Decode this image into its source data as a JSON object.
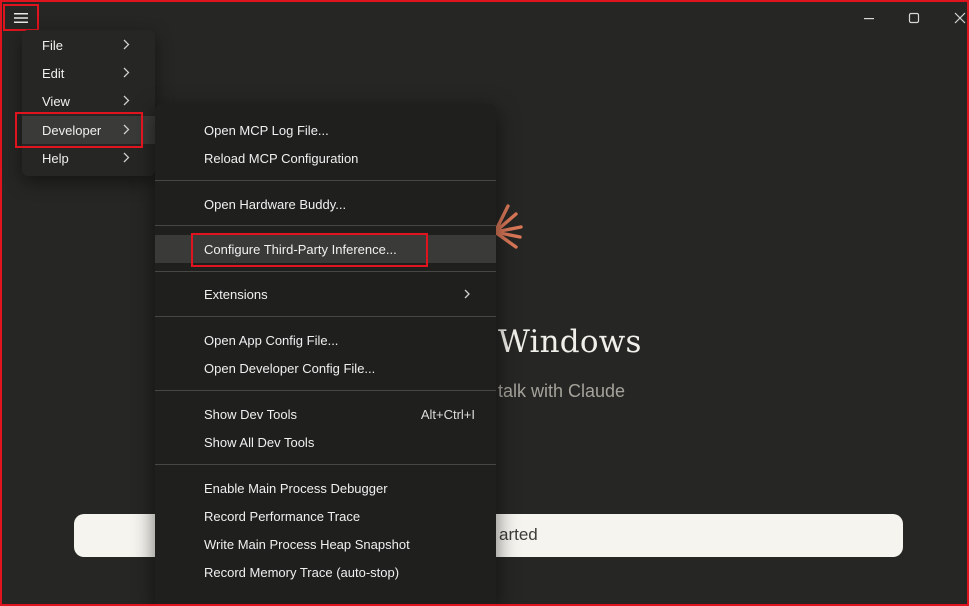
{
  "titlebar": {
    "menu_button_icon": "hamburger-icon",
    "minimize_icon": "minimize-icon",
    "maximize_icon": "maximize-icon",
    "close_icon": "close-icon"
  },
  "welcome": {
    "title_fragment": "Windows",
    "subtitle_fragment": "talk with Claude",
    "button_fragment": "arted"
  },
  "main_menu": {
    "items": [
      {
        "label": "File"
      },
      {
        "label": "Edit"
      },
      {
        "label": "View"
      },
      {
        "label": "Developer"
      },
      {
        "label": "Help"
      }
    ]
  },
  "developer_menu": {
    "items": [
      {
        "label": "Open MCP Log File..."
      },
      {
        "label": "Reload MCP Configuration"
      },
      {
        "label": "Open Hardware Buddy..."
      },
      {
        "label": "Configure Third-Party Inference..."
      },
      {
        "label": "Extensions"
      },
      {
        "label": "Open App Config File..."
      },
      {
        "label": "Open Developer Config File..."
      },
      {
        "label": "Show Dev Tools",
        "shortcut": "Alt+Ctrl+I"
      },
      {
        "label": "Show All Dev Tools"
      },
      {
        "label": "Enable Main Process Debugger"
      },
      {
        "label": "Record Performance Trace"
      },
      {
        "label": "Write Main Process Heap Snapshot"
      },
      {
        "label": "Record Memory Trace (auto-stop)"
      }
    ]
  },
  "colors": {
    "background": "#262624",
    "submenu_background": "#1f1f1e",
    "highlight_row": "#3a3a38",
    "annotation_red": "#e0141e",
    "accent_spark": "#d97757"
  }
}
